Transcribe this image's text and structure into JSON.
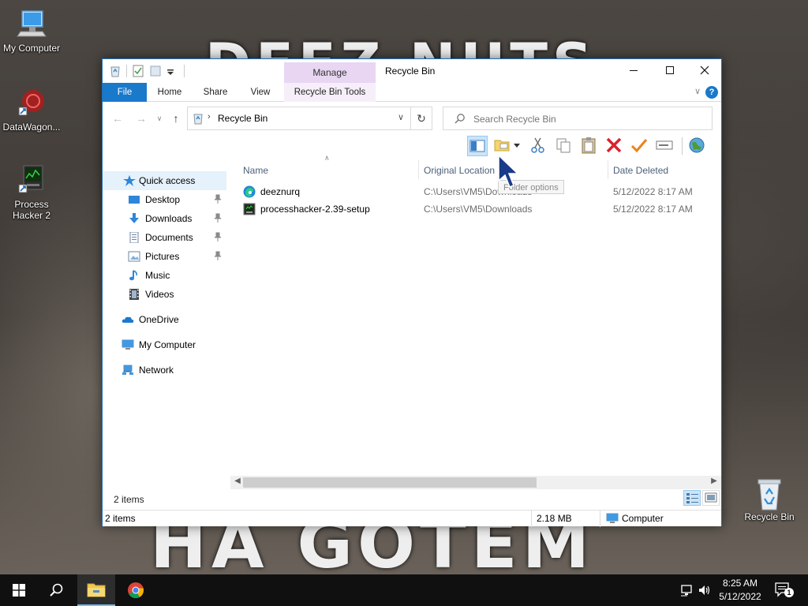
{
  "desktop": {
    "wallpaper_text_top": "DEEZ NUTS",
    "wallpaper_text_bottom": "HA GOTEM",
    "icons": [
      {
        "label": "My Computer"
      },
      {
        "label": "DataWagon..."
      },
      {
        "label": "Process Hacker 2"
      },
      {
        "label": "Recycle Bin"
      }
    ]
  },
  "window": {
    "title": "Recycle Bin",
    "context_tab": "Manage",
    "tabs": {
      "file": "File",
      "home": "Home",
      "share": "Share",
      "view": "View",
      "tools": "Recycle Bin Tools"
    },
    "help": "?",
    "address": {
      "path": "Recycle Bin"
    },
    "search": {
      "placeholder": "Search Recycle Bin"
    },
    "tooltip": "Folder options"
  },
  "navpane": {
    "items": [
      {
        "label": "Quick access"
      },
      {
        "label": "Desktop"
      },
      {
        "label": "Downloads"
      },
      {
        "label": "Documents"
      },
      {
        "label": "Pictures"
      },
      {
        "label": "Music"
      },
      {
        "label": "Videos"
      },
      {
        "label": "OneDrive"
      },
      {
        "label": "My Computer"
      },
      {
        "label": "Network"
      }
    ]
  },
  "filelist": {
    "columns": [
      "Name",
      "Original Location",
      "Date Deleted"
    ],
    "rows": [
      {
        "name": "deeznurq",
        "location": "C:\\Users\\VM5\\Downloads",
        "deleted": "5/12/2022 8:17 AM"
      },
      {
        "name": "processhacker-2.39-setup",
        "location": "C:\\Users\\VM5\\Downloads",
        "deleted": "5/12/2022 8:17 AM"
      }
    ],
    "count_label": "2 items"
  },
  "statusbar": {
    "items": "2 items",
    "size": "2.18 MB",
    "location": "Computer"
  },
  "taskbar": {
    "time": "8:25 AM",
    "date": "5/12/2022",
    "notifications": "1"
  },
  "colors": {
    "accent": "#1979ca",
    "context_tab": "#e8d6f3",
    "delete_red": "#d9232d",
    "restore_orange": "#e8851c"
  }
}
